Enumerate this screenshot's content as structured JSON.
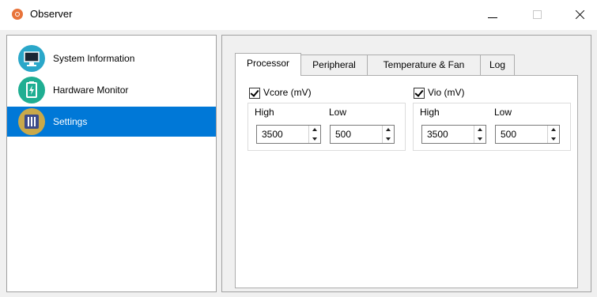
{
  "window": {
    "title": "Observer"
  },
  "sidebar": {
    "items": [
      {
        "label": "System Information",
        "icon": "monitor-icon",
        "color": "#2aa7c9"
      },
      {
        "label": "Hardware Monitor",
        "icon": "battery-icon",
        "color": "#1fae92"
      },
      {
        "label": "Settings",
        "icon": "sliders-icon",
        "color": "#c9a94a",
        "selected": true
      }
    ]
  },
  "tabs": [
    {
      "label": "Processor",
      "active": true
    },
    {
      "label": "Peripheral"
    },
    {
      "label": "Temperature & Fan"
    },
    {
      "label": "Log"
    }
  ],
  "processor": {
    "vcore": {
      "label": "Vcore (mV)",
      "checked": true,
      "high_label": "High",
      "low_label": "Low",
      "high": "3500",
      "low": "500"
    },
    "vio": {
      "label": "Vio (mV)",
      "checked": true,
      "high_label": "High",
      "low_label": "Low",
      "high": "3500",
      "low": "500"
    }
  },
  "colors": {
    "selection": "#0078d7"
  }
}
